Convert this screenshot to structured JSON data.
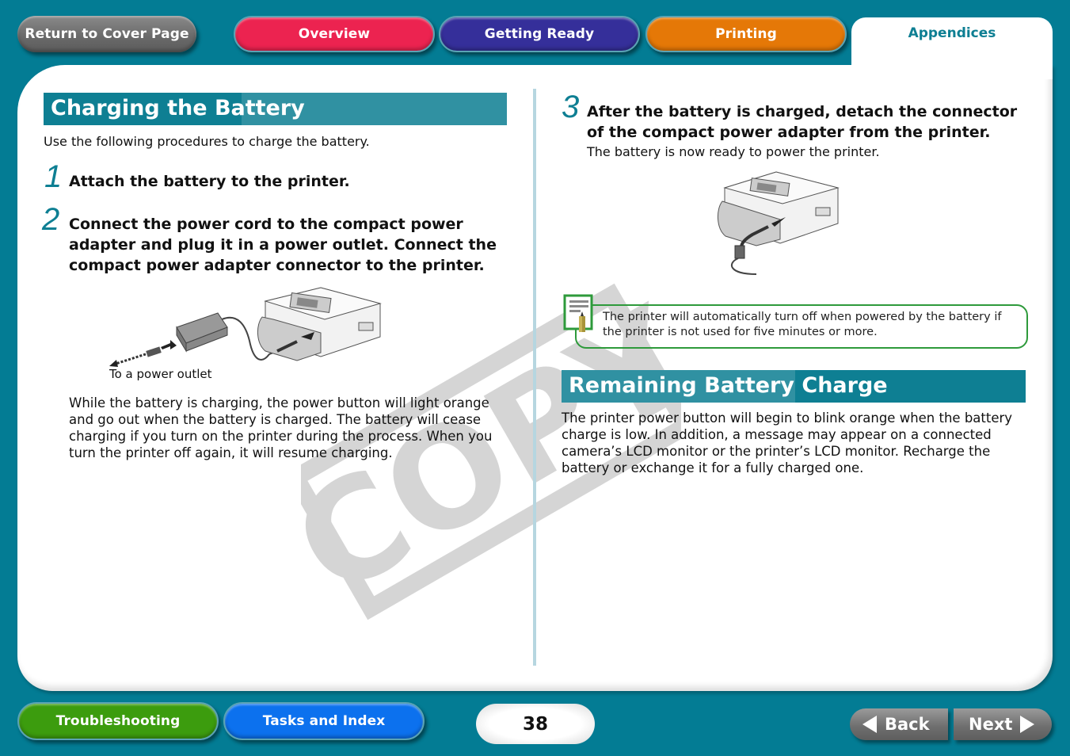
{
  "top_nav": {
    "cover_label": "Return to Cover Page",
    "tabs": [
      {
        "label": "Overview",
        "color": "#ec2350"
      },
      {
        "label": "Getting Ready",
        "color": "#352f9a"
      },
      {
        "label": "Printing",
        "color": "#e57807"
      },
      {
        "label": "Appendices",
        "color": "#0e7f93",
        "active": true
      }
    ]
  },
  "left": {
    "heading": "Charging the Battery",
    "intro": "Use the following procedures to charge the battery.",
    "steps": [
      {
        "num": "1",
        "text": "Attach the battery to the printer."
      },
      {
        "num": "2",
        "text": "Connect the power cord to the compact power adapter and plug it in a power outlet. Connect the compact power adapter connector to the printer."
      }
    ],
    "figure_caption": "To a power outlet",
    "paragraph": "While the battery is charging, the power button will light orange and go out when the battery is charged. The battery will cease charging if you turn on the printer during the process. When you turn the printer off again, it will resume charging."
  },
  "right": {
    "step3": {
      "num": "3",
      "text": "After the battery is charged, detach the connector of the compact power adapter from the printer.",
      "sub": "The battery is now ready to power the printer."
    },
    "note": "The printer will automatically turn off when powered by the battery if the printer is not used for five minutes or more.",
    "heading": "Remaining Battery Charge",
    "paragraph": "The printer power button will begin to blink orange when the battery charge is low. In addition, a message may appear on a connected camera’s LCD monitor or the printer’s LCD monitor. Recharge the battery or exchange it for a fully charged one."
  },
  "watermark": "COPY",
  "bottom_nav": {
    "troubleshooting_label": "Troubleshooting",
    "tasks_label": "Tasks and Index",
    "page_number": "38",
    "back_label": "Back",
    "next_label": "Next"
  },
  "icons": {
    "note": "note-pencil-icon",
    "back": "triangle-left-icon",
    "next": "triangle-right-icon"
  },
  "colors": {
    "background": "#037c94",
    "accent": "#0e7f93",
    "note_border": "#2e9a3b"
  }
}
